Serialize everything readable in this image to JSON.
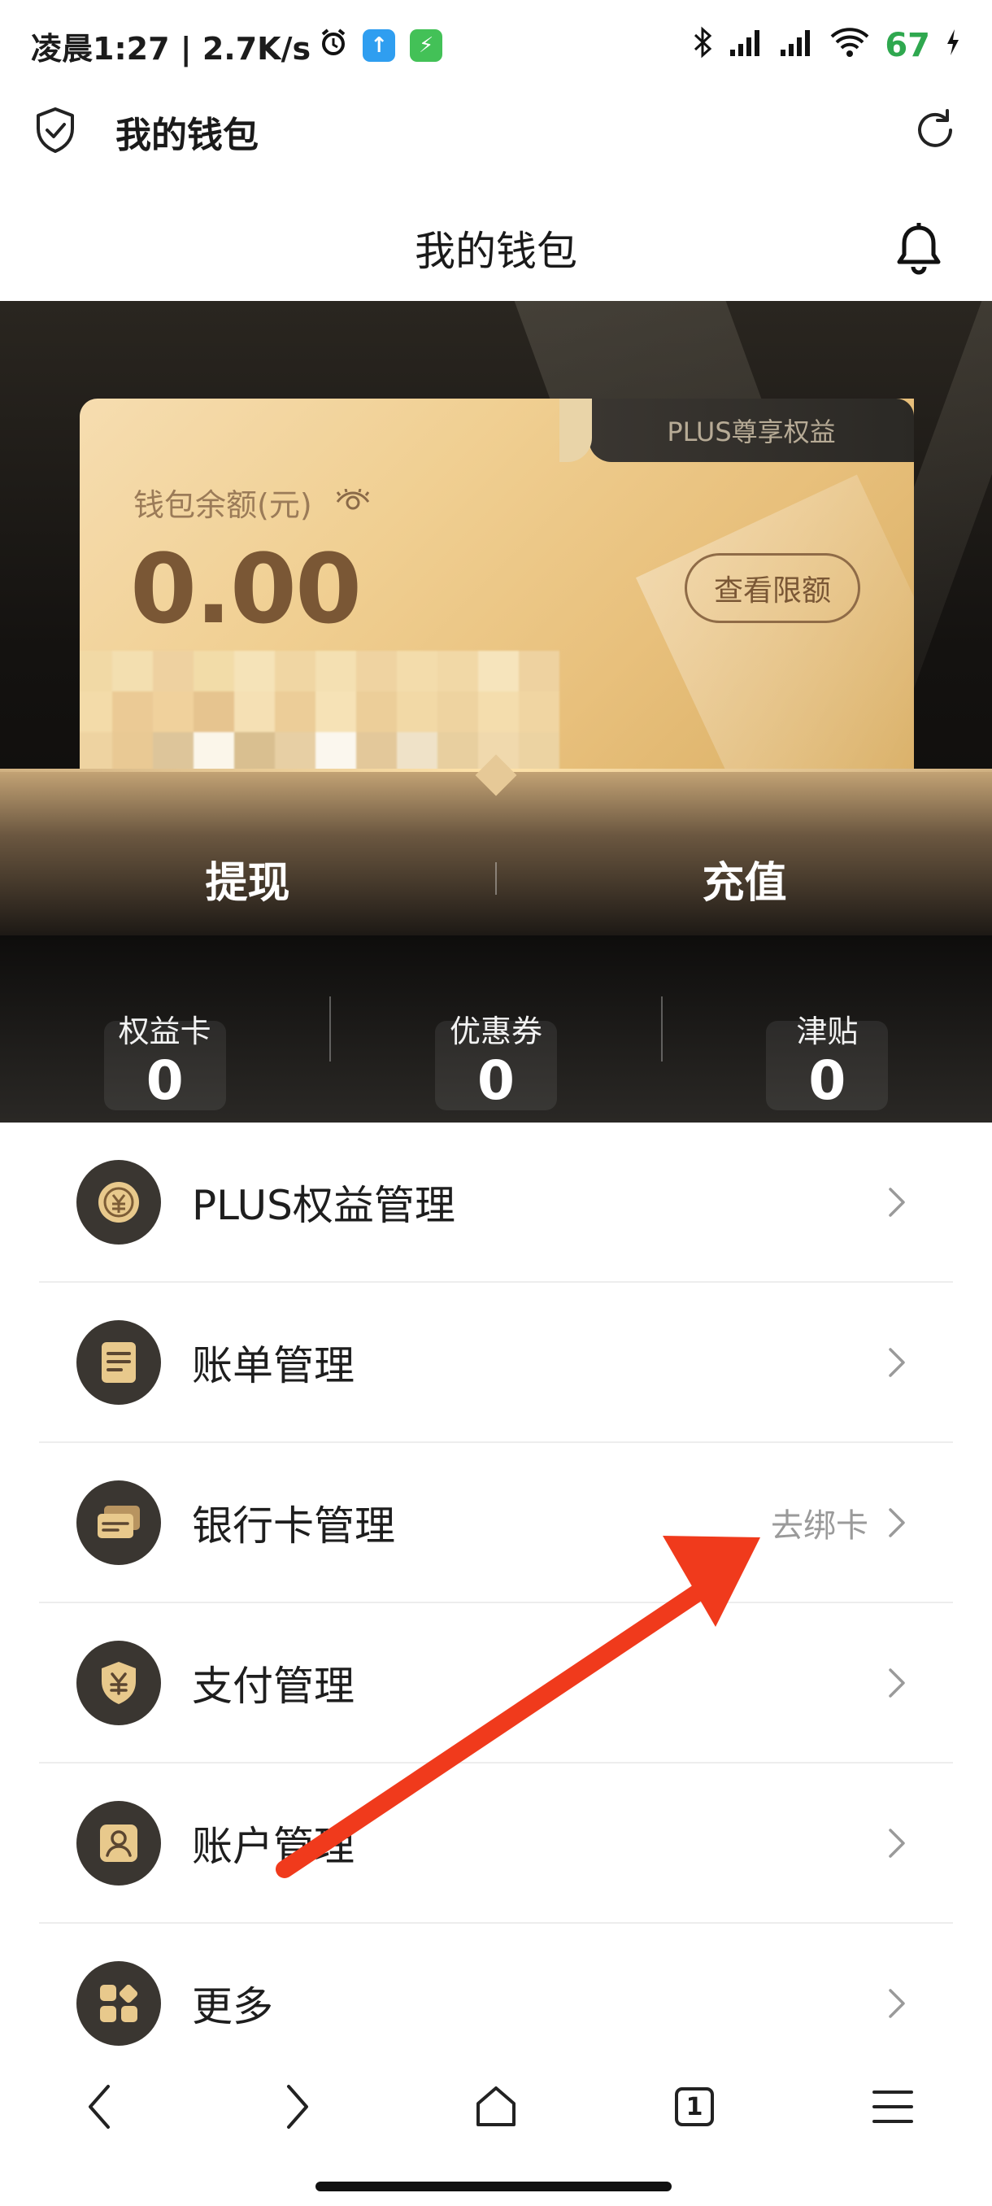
{
  "status_bar": {
    "time_text": "凌晨1:27 | 2.7K/s",
    "battery": "67"
  },
  "browser": {
    "title": "我的钱包"
  },
  "header": {
    "title": "我的钱包"
  },
  "wallet_card": {
    "plus_tab": "PLUS尊享权益",
    "balance_label": "钱包余额(元)",
    "balance_value": "0.00",
    "limit_button": "查看限额"
  },
  "actions": {
    "withdraw": "提现",
    "recharge": "充值"
  },
  "stats": [
    {
      "label": "权益卡",
      "value": "0"
    },
    {
      "label": "优惠券",
      "value": "0"
    },
    {
      "label": "津贴",
      "value": "0"
    }
  ],
  "menu": [
    {
      "label": "PLUS权益管理",
      "extra": "",
      "icon": "coin-icon"
    },
    {
      "label": "账单管理",
      "extra": "",
      "icon": "bill-icon"
    },
    {
      "label": "银行卡管理",
      "extra": "去绑卡",
      "icon": "bank-card-icon"
    },
    {
      "label": "支付管理",
      "extra": "",
      "icon": "payment-shield-icon"
    },
    {
      "label": "账户管理",
      "extra": "",
      "icon": "account-icon"
    },
    {
      "label": "更多",
      "extra": "",
      "icon": "more-grid-icon"
    }
  ],
  "bottom_nav": {
    "tab_count": "1"
  },
  "colors": {
    "gold_card": "#f0cf92",
    "dark_bg": "#141210",
    "annotation_arrow": "#f03a1c"
  }
}
